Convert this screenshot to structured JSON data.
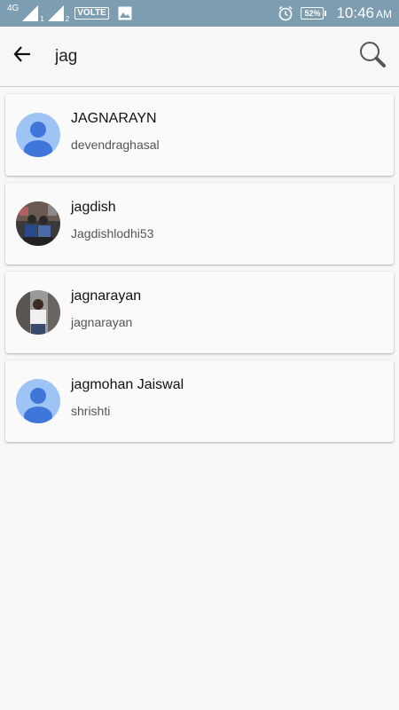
{
  "status_bar": {
    "network": "4G",
    "sim1_label": "1",
    "sim2_label": "2",
    "volte": "VOLTE",
    "battery": "52%",
    "time": "10:46",
    "ampm": "AM"
  },
  "search": {
    "value": "jag"
  },
  "results": [
    {
      "name": "JAGNARAYN",
      "username": "devendraghasal",
      "avatar": "default-avatar"
    },
    {
      "name": "jagdish",
      "username": "Jagdishlodhi53",
      "avatar": "photo-avatar"
    },
    {
      "name": "jagnarayan",
      "username": "jagnarayan",
      "avatar": "photo-avatar"
    },
    {
      "name": "jagmohan Jaiswal",
      "username": "shrishti",
      "avatar": "default-avatar"
    }
  ],
  "colors": {
    "status_bar": "#7d9db0",
    "default_avatar_bg": "#9ec3f5",
    "default_avatar_fg": "#3f76d9"
  }
}
